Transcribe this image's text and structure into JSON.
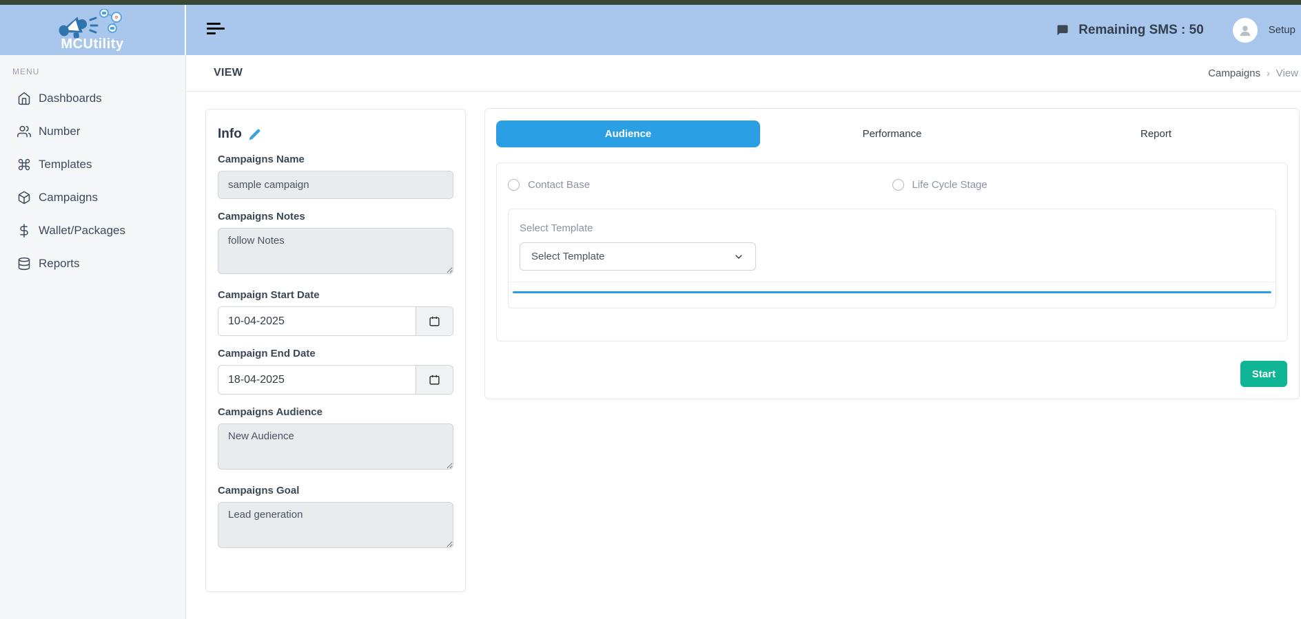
{
  "brand": {
    "name": "MCUtility"
  },
  "header": {
    "remaining_sms": "Remaining SMS : 50",
    "setup_label": "Setup"
  },
  "sidebar": {
    "menu_label": "MENU",
    "items": [
      {
        "label": "Dashboards",
        "icon": "home-icon"
      },
      {
        "label": "Number",
        "icon": "users-icon"
      },
      {
        "label": "Templates",
        "icon": "command-icon"
      },
      {
        "label": "Campaigns",
        "icon": "package-icon"
      },
      {
        "label": "Wallet/Packages",
        "icon": "dollar-icon"
      },
      {
        "label": "Reports",
        "icon": "database-icon"
      }
    ]
  },
  "page": {
    "title": "VIEW",
    "breadcrumb": {
      "parent": "Campaigns",
      "separator": "›",
      "current": "View"
    }
  },
  "info_card": {
    "title": "Info",
    "name_label": "Campaigns Name",
    "name_value": "sample campaign",
    "notes_label": "Campaigns Notes",
    "notes_value": "follow Notes",
    "start_label": "Campaign Start Date",
    "start_value": "10-04-2025",
    "end_label": "Campaign End Date",
    "end_value": "18-04-2025",
    "audience_label": "Campaigns Audience",
    "audience_value": "New Audience",
    "goal_label": "Campaigns Goal",
    "goal_value": "Lead generation"
  },
  "tabs": {
    "items": [
      {
        "label": "Audience",
        "active": true
      },
      {
        "label": "Performance",
        "active": false
      },
      {
        "label": "Report",
        "active": false
      }
    ]
  },
  "audience_panel": {
    "radio_contact_label": "Contact Base",
    "radio_lifecycle_label": "Life Cycle Stage",
    "select_label": "Select Template",
    "select_value": "Select Template",
    "start_button_label": "Start"
  },
  "colors": {
    "top_strip": "#3a4733",
    "header_blue": "#a9c7ec",
    "active_tab_blue": "#2b9fe3",
    "accent_line_blue": "#2b9fe3",
    "start_button_green": "#10b596"
  }
}
